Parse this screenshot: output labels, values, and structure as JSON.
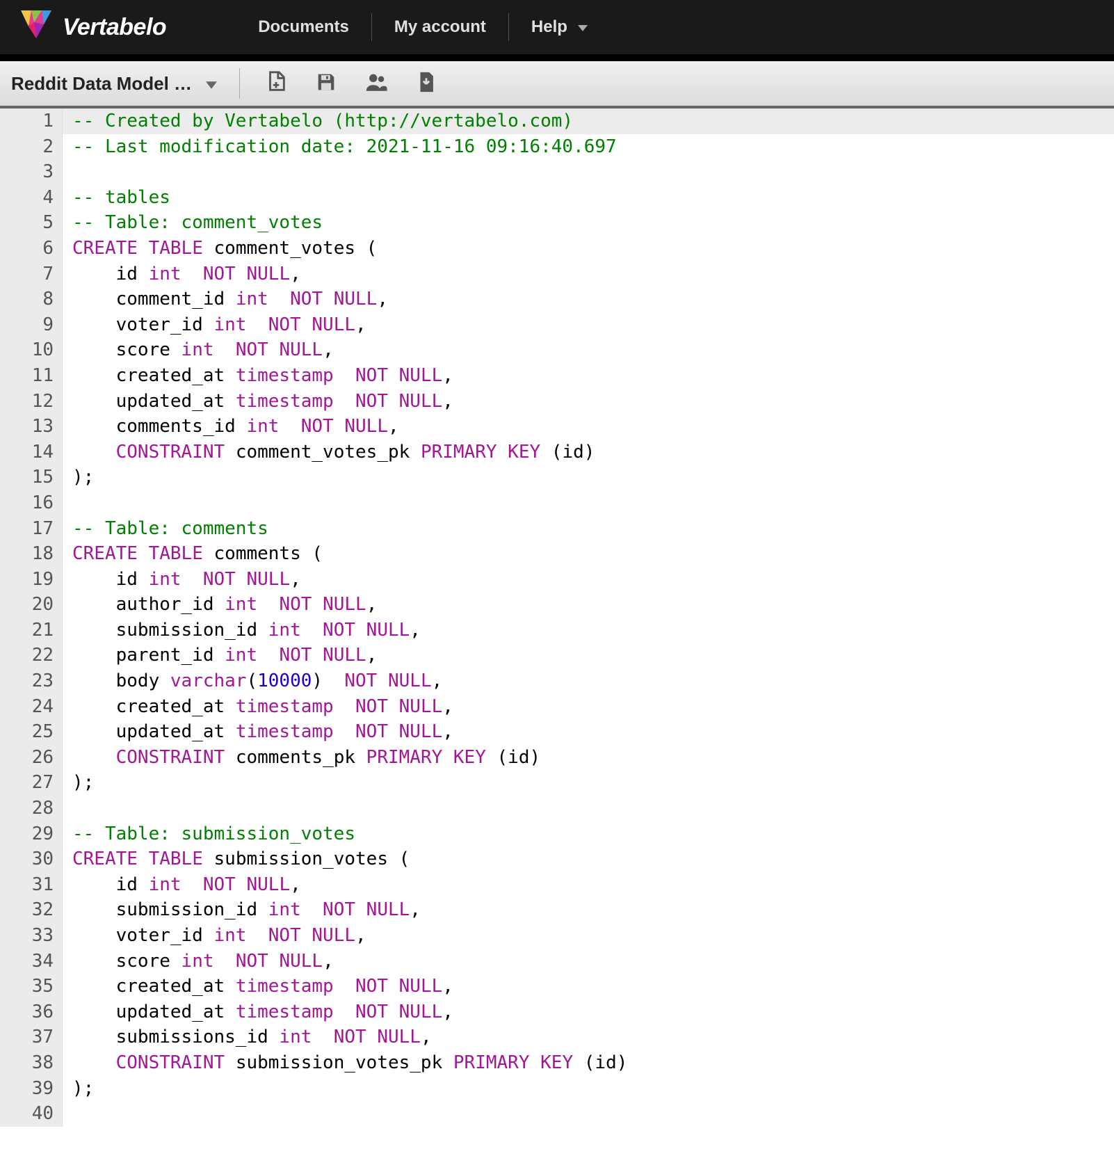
{
  "brand": "Vertabelo",
  "nav": {
    "documents": "Documents",
    "account": "My account",
    "help": "Help"
  },
  "toolbar": {
    "model_name": "Reddit Data Model …"
  },
  "code_lines": [
    [
      [
        "comment",
        "-- Created by Vertabelo (http://vertabelo.com)"
      ]
    ],
    [
      [
        "comment",
        "-- Last modification date: 2021-11-16 09:16:40.697"
      ]
    ],
    [],
    [
      [
        "comment",
        "-- tables"
      ]
    ],
    [
      [
        "comment",
        "-- Table: comment_votes"
      ]
    ],
    [
      [
        "kw",
        "CREATE"
      ],
      [
        "txt",
        " "
      ],
      [
        "kw",
        "TABLE"
      ],
      [
        "txt",
        " comment_votes ("
      ]
    ],
    [
      [
        "txt",
        "    id "
      ],
      [
        "kw2",
        "int"
      ],
      [
        "txt",
        "  "
      ],
      [
        "kw",
        "NOT"
      ],
      [
        "txt",
        " "
      ],
      [
        "kw",
        "NULL"
      ],
      [
        "txt",
        ","
      ]
    ],
    [
      [
        "txt",
        "    comment_id "
      ],
      [
        "kw2",
        "int"
      ],
      [
        "txt",
        "  "
      ],
      [
        "kw",
        "NOT"
      ],
      [
        "txt",
        " "
      ],
      [
        "kw",
        "NULL"
      ],
      [
        "txt",
        ","
      ]
    ],
    [
      [
        "txt",
        "    voter_id "
      ],
      [
        "kw2",
        "int"
      ],
      [
        "txt",
        "  "
      ],
      [
        "kw",
        "NOT"
      ],
      [
        "txt",
        " "
      ],
      [
        "kw",
        "NULL"
      ],
      [
        "txt",
        ","
      ]
    ],
    [
      [
        "txt",
        "    score "
      ],
      [
        "kw2",
        "int"
      ],
      [
        "txt",
        "  "
      ],
      [
        "kw",
        "NOT"
      ],
      [
        "txt",
        " "
      ],
      [
        "kw",
        "NULL"
      ],
      [
        "txt",
        ","
      ]
    ],
    [
      [
        "txt",
        "    created_at "
      ],
      [
        "kw2",
        "timestamp"
      ],
      [
        "txt",
        "  "
      ],
      [
        "kw",
        "NOT"
      ],
      [
        "txt",
        " "
      ],
      [
        "kw",
        "NULL"
      ],
      [
        "txt",
        ","
      ]
    ],
    [
      [
        "txt",
        "    updated_at "
      ],
      [
        "kw2",
        "timestamp"
      ],
      [
        "txt",
        "  "
      ],
      [
        "kw",
        "NOT"
      ],
      [
        "txt",
        " "
      ],
      [
        "kw",
        "NULL"
      ],
      [
        "txt",
        ","
      ]
    ],
    [
      [
        "txt",
        "    comments_id "
      ],
      [
        "kw2",
        "int"
      ],
      [
        "txt",
        "  "
      ],
      [
        "kw",
        "NOT"
      ],
      [
        "txt",
        " "
      ],
      [
        "kw",
        "NULL"
      ],
      [
        "txt",
        ","
      ]
    ],
    [
      [
        "txt",
        "    "
      ],
      [
        "kw",
        "CONSTRAINT"
      ],
      [
        "txt",
        " comment_votes_pk "
      ],
      [
        "kw",
        "PRIMARY"
      ],
      [
        "txt",
        " "
      ],
      [
        "kw",
        "KEY"
      ],
      [
        "txt",
        " (id)"
      ]
    ],
    [
      [
        "txt",
        ");"
      ]
    ],
    [],
    [
      [
        "comment",
        "-- Table: comments"
      ]
    ],
    [
      [
        "kw",
        "CREATE"
      ],
      [
        "txt",
        " "
      ],
      [
        "kw",
        "TABLE"
      ],
      [
        "txt",
        " comments ("
      ]
    ],
    [
      [
        "txt",
        "    id "
      ],
      [
        "kw2",
        "int"
      ],
      [
        "txt",
        "  "
      ],
      [
        "kw",
        "NOT"
      ],
      [
        "txt",
        " "
      ],
      [
        "kw",
        "NULL"
      ],
      [
        "txt",
        ","
      ]
    ],
    [
      [
        "txt",
        "    author_id "
      ],
      [
        "kw2",
        "int"
      ],
      [
        "txt",
        "  "
      ],
      [
        "kw",
        "NOT"
      ],
      [
        "txt",
        " "
      ],
      [
        "kw",
        "NULL"
      ],
      [
        "txt",
        ","
      ]
    ],
    [
      [
        "txt",
        "    submission_id "
      ],
      [
        "kw2",
        "int"
      ],
      [
        "txt",
        "  "
      ],
      [
        "kw",
        "NOT"
      ],
      [
        "txt",
        " "
      ],
      [
        "kw",
        "NULL"
      ],
      [
        "txt",
        ","
      ]
    ],
    [
      [
        "txt",
        "    parent_id "
      ],
      [
        "kw2",
        "int"
      ],
      [
        "txt",
        "  "
      ],
      [
        "kw",
        "NOT"
      ],
      [
        "txt",
        " "
      ],
      [
        "kw",
        "NULL"
      ],
      [
        "txt",
        ","
      ]
    ],
    [
      [
        "txt",
        "    body "
      ],
      [
        "kw2",
        "varchar"
      ],
      [
        "txt",
        "("
      ],
      [
        "num",
        "10000"
      ],
      [
        "txt",
        ")  "
      ],
      [
        "kw",
        "NOT"
      ],
      [
        "txt",
        " "
      ],
      [
        "kw",
        "NULL"
      ],
      [
        "txt",
        ","
      ]
    ],
    [
      [
        "txt",
        "    created_at "
      ],
      [
        "kw2",
        "timestamp"
      ],
      [
        "txt",
        "  "
      ],
      [
        "kw",
        "NOT"
      ],
      [
        "txt",
        " "
      ],
      [
        "kw",
        "NULL"
      ],
      [
        "txt",
        ","
      ]
    ],
    [
      [
        "txt",
        "    updated_at "
      ],
      [
        "kw2",
        "timestamp"
      ],
      [
        "txt",
        "  "
      ],
      [
        "kw",
        "NOT"
      ],
      [
        "txt",
        " "
      ],
      [
        "kw",
        "NULL"
      ],
      [
        "txt",
        ","
      ]
    ],
    [
      [
        "txt",
        "    "
      ],
      [
        "kw",
        "CONSTRAINT"
      ],
      [
        "txt",
        " comments_pk "
      ],
      [
        "kw",
        "PRIMARY"
      ],
      [
        "txt",
        " "
      ],
      [
        "kw",
        "KEY"
      ],
      [
        "txt",
        " (id)"
      ]
    ],
    [
      [
        "txt",
        ");"
      ]
    ],
    [],
    [
      [
        "comment",
        "-- Table: submission_votes"
      ]
    ],
    [
      [
        "kw",
        "CREATE"
      ],
      [
        "txt",
        " "
      ],
      [
        "kw",
        "TABLE"
      ],
      [
        "txt",
        " submission_votes ("
      ]
    ],
    [
      [
        "txt",
        "    id "
      ],
      [
        "kw2",
        "int"
      ],
      [
        "txt",
        "  "
      ],
      [
        "kw",
        "NOT"
      ],
      [
        "txt",
        " "
      ],
      [
        "kw",
        "NULL"
      ],
      [
        "txt",
        ","
      ]
    ],
    [
      [
        "txt",
        "    submission_id "
      ],
      [
        "kw2",
        "int"
      ],
      [
        "txt",
        "  "
      ],
      [
        "kw",
        "NOT"
      ],
      [
        "txt",
        " "
      ],
      [
        "kw",
        "NULL"
      ],
      [
        "txt",
        ","
      ]
    ],
    [
      [
        "txt",
        "    voter_id "
      ],
      [
        "kw2",
        "int"
      ],
      [
        "txt",
        "  "
      ],
      [
        "kw",
        "NOT"
      ],
      [
        "txt",
        " "
      ],
      [
        "kw",
        "NULL"
      ],
      [
        "txt",
        ","
      ]
    ],
    [
      [
        "txt",
        "    score "
      ],
      [
        "kw2",
        "int"
      ],
      [
        "txt",
        "  "
      ],
      [
        "kw",
        "NOT"
      ],
      [
        "txt",
        " "
      ],
      [
        "kw",
        "NULL"
      ],
      [
        "txt",
        ","
      ]
    ],
    [
      [
        "txt",
        "    created_at "
      ],
      [
        "kw2",
        "timestamp"
      ],
      [
        "txt",
        "  "
      ],
      [
        "kw",
        "NOT"
      ],
      [
        "txt",
        " "
      ],
      [
        "kw",
        "NULL"
      ],
      [
        "txt",
        ","
      ]
    ],
    [
      [
        "txt",
        "    updated_at "
      ],
      [
        "kw2",
        "timestamp"
      ],
      [
        "txt",
        "  "
      ],
      [
        "kw",
        "NOT"
      ],
      [
        "txt",
        " "
      ],
      [
        "kw",
        "NULL"
      ],
      [
        "txt",
        ","
      ]
    ],
    [
      [
        "txt",
        "    submissions_id "
      ],
      [
        "kw2",
        "int"
      ],
      [
        "txt",
        "  "
      ],
      [
        "kw",
        "NOT"
      ],
      [
        "txt",
        " "
      ],
      [
        "kw",
        "NULL"
      ],
      [
        "txt",
        ","
      ]
    ],
    [
      [
        "txt",
        "    "
      ],
      [
        "kw",
        "CONSTRAINT"
      ],
      [
        "txt",
        " submission_votes_pk "
      ],
      [
        "kw",
        "PRIMARY"
      ],
      [
        "txt",
        " "
      ],
      [
        "kw",
        "KEY"
      ],
      [
        "txt",
        " (id)"
      ]
    ],
    [
      [
        "txt",
        ");"
      ]
    ],
    []
  ]
}
